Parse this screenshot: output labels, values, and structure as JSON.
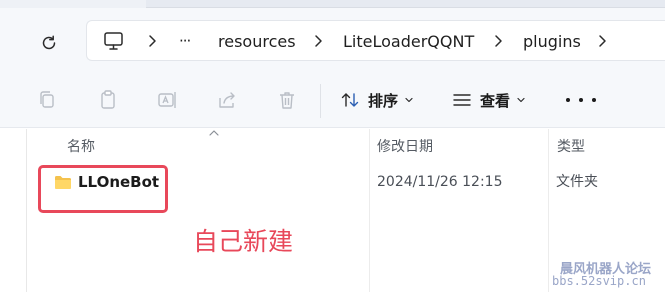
{
  "address_bar": {
    "icon": "this-pc-icon",
    "more_label": "···",
    "crumbs": [
      "resources",
      "LiteLoaderQQNT",
      "plugins"
    ]
  },
  "toolbar": {
    "sort_label": "排序",
    "view_label": "查看",
    "icons": [
      "copy-icon",
      "paste-icon",
      "rename-icon",
      "share-icon",
      "delete-icon"
    ]
  },
  "columns": {
    "name": "名称",
    "modified": "修改日期",
    "type": "类型"
  },
  "files": [
    {
      "name": "LLOneBot",
      "modified": "2024/11/26 12:15",
      "type": "文件夹"
    }
  ],
  "annotation": {
    "text": "自己新建",
    "color": "#e8485a"
  },
  "watermark": {
    "line1": "晨风机器人论坛",
    "line2": "bbs.52svip.cn"
  }
}
